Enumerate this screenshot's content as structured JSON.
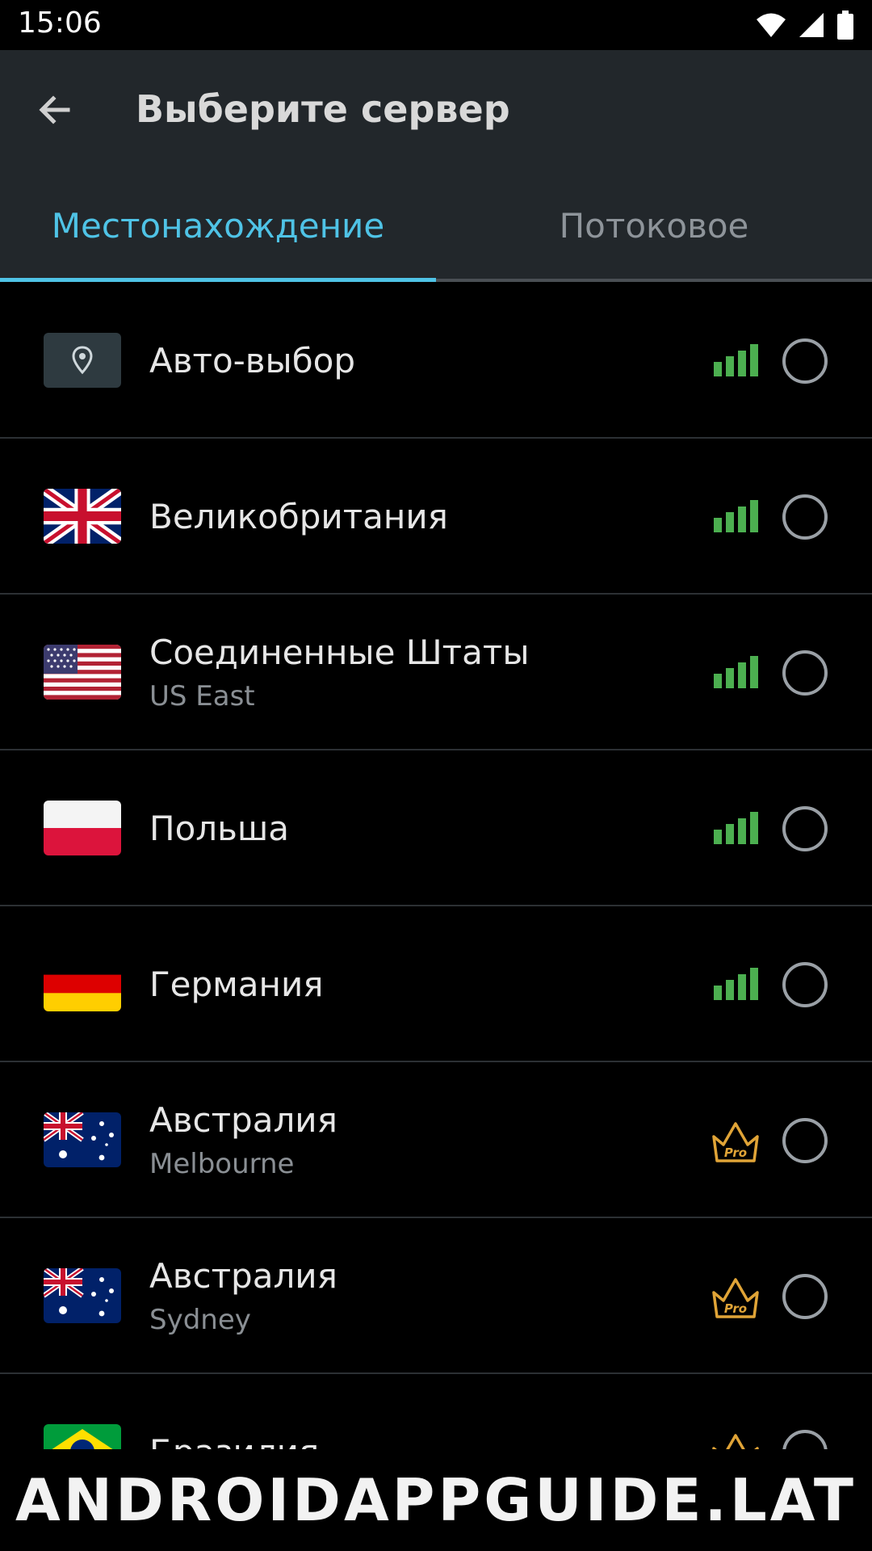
{
  "status_bar": {
    "time": "15:06"
  },
  "app_bar": {
    "title": "Выберите сервер"
  },
  "tabs": [
    {
      "label": "Местонахождение",
      "active": true
    },
    {
      "label": "Потоковое",
      "active": false
    }
  ],
  "colors": {
    "accent": "#4fc3e6",
    "signal": "#4caf50",
    "pro": "#e0a437"
  },
  "servers": [
    {
      "name": "Авто-выбор",
      "sub": "",
      "icon": "location-pin-icon",
      "indicator": "signal"
    },
    {
      "name": "Великобритания",
      "sub": "",
      "icon": "uk-flag-icon",
      "indicator": "signal"
    },
    {
      "name": "Соединенные Штаты",
      "sub": "US East",
      "icon": "us-flag-icon",
      "indicator": "signal"
    },
    {
      "name": "Польша",
      "sub": "",
      "icon": "poland-flag-icon",
      "indicator": "signal"
    },
    {
      "name": "Германия",
      "sub": "",
      "icon": "germany-flag-icon",
      "indicator": "signal"
    },
    {
      "name": "Австралия",
      "sub": "Melbourne",
      "icon": "australia-flag-icon",
      "indicator": "pro"
    },
    {
      "name": "Австралия",
      "sub": "Sydney",
      "icon": "australia-flag-icon",
      "indicator": "pro"
    },
    {
      "name": "Бразилия",
      "sub": "",
      "icon": "brazil-flag-icon",
      "indicator": "pro"
    }
  ],
  "pro_label": "Pro",
  "watermark": "ANDROIDAPPGUIDE.LAT"
}
